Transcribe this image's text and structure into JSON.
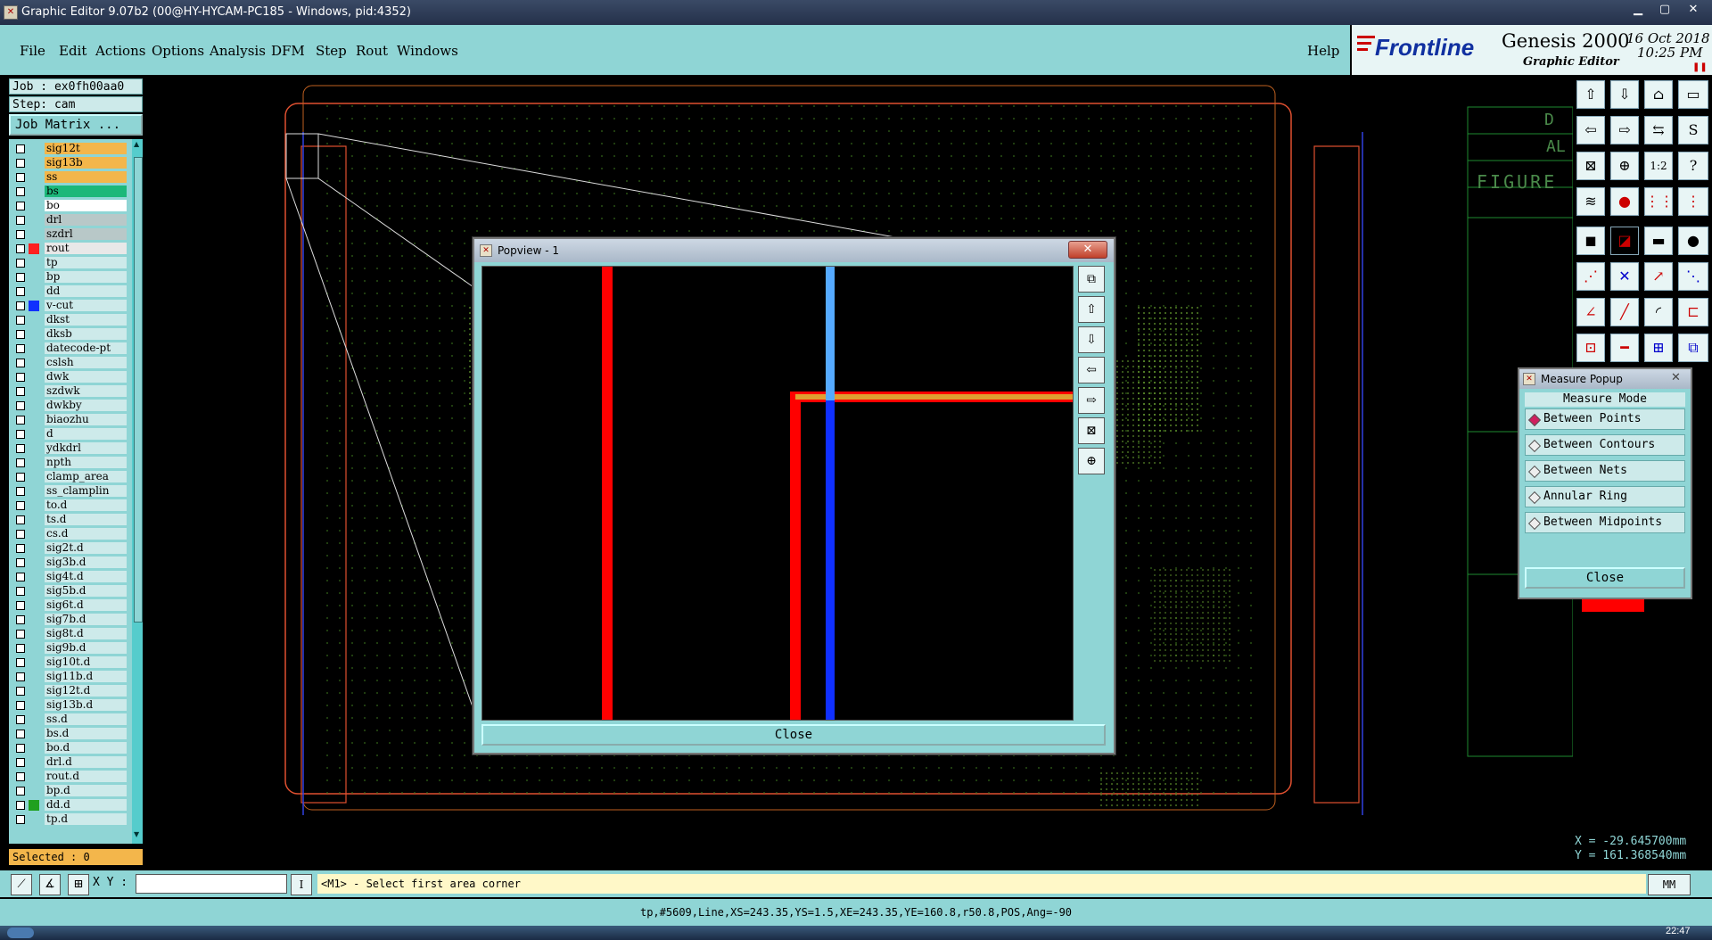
{
  "window": {
    "title": "Graphic Editor 9.07b2 (00@HY-HYCAM-PC185 - Windows, pid:4352)"
  },
  "menu": {
    "items": [
      "File",
      "Edit",
      "Actions",
      "Options",
      "Analysis",
      "DFM",
      "Step",
      "Rout",
      "Windows"
    ],
    "help": "Help"
  },
  "brand": {
    "logo": "Frontline",
    "product": "Genesis 2000",
    "subtitle": "Graphic Editor",
    "date": "16 Oct 2018",
    "time": "10:25 PM"
  },
  "job": {
    "job_label": "Job : ex0fh00aa0",
    "step_label": "Step: cam",
    "matrix_button": "Job Matrix ..."
  },
  "layers": [
    {
      "name": "sig12t",
      "color": "#f3b64b",
      "swatch": ""
    },
    {
      "name": "sig13b",
      "color": "#f3b64b",
      "swatch": ""
    },
    {
      "name": "ss",
      "color": "#f3b64b",
      "swatch": ""
    },
    {
      "name": "bs",
      "color": "#1cb87a",
      "swatch": ""
    },
    {
      "name": "bo",
      "color": "#ffffff",
      "swatch": ""
    },
    {
      "name": "drl",
      "color": "#b8c8c8",
      "swatch": ""
    },
    {
      "name": "szdrl",
      "color": "#b8c8c8",
      "swatch": ""
    },
    {
      "name": "rout",
      "color": "#e8e8e8",
      "swatch": "#ff2020"
    },
    {
      "name": "tp",
      "color": "#cdeaea",
      "swatch": ""
    },
    {
      "name": "bp",
      "color": "#cdeaea",
      "swatch": ""
    },
    {
      "name": "dd",
      "color": "#cdeaea",
      "swatch": ""
    },
    {
      "name": "v-cut",
      "color": "#cdeaea",
      "swatch": "#1030ff"
    },
    {
      "name": "dkst",
      "color": "#cdeaea",
      "swatch": ""
    },
    {
      "name": "dksb",
      "color": "#cdeaea",
      "swatch": ""
    },
    {
      "name": "datecode-pt",
      "color": "#cdeaea",
      "swatch": ""
    },
    {
      "name": "cslsh",
      "color": "#cdeaea",
      "swatch": ""
    },
    {
      "name": "dwk",
      "color": "#cdeaea",
      "swatch": ""
    },
    {
      "name": "szdwk",
      "color": "#cdeaea",
      "swatch": ""
    },
    {
      "name": "dwkby",
      "color": "#cdeaea",
      "swatch": ""
    },
    {
      "name": "biaozhu",
      "color": "#cdeaea",
      "swatch": ""
    },
    {
      "name": "d",
      "color": "#cdeaea",
      "swatch": ""
    },
    {
      "name": "ydkdrl",
      "color": "#cdeaea",
      "swatch": ""
    },
    {
      "name": "npth",
      "color": "#cdeaea",
      "swatch": ""
    },
    {
      "name": "clamp_area",
      "color": "#cdeaea",
      "swatch": ""
    },
    {
      "name": "ss_clamplin",
      "color": "#cdeaea",
      "swatch": ""
    },
    {
      "name": "to.d",
      "color": "#cdeaea",
      "swatch": ""
    },
    {
      "name": "ts.d",
      "color": "#cdeaea",
      "swatch": ""
    },
    {
      "name": "cs.d",
      "color": "#cdeaea",
      "swatch": ""
    },
    {
      "name": "sig2t.d",
      "color": "#cdeaea",
      "swatch": ""
    },
    {
      "name": "sig3b.d",
      "color": "#cdeaea",
      "swatch": ""
    },
    {
      "name": "sig4t.d",
      "color": "#cdeaea",
      "swatch": ""
    },
    {
      "name": "sig5b.d",
      "color": "#cdeaea",
      "swatch": ""
    },
    {
      "name": "sig6t.d",
      "color": "#cdeaea",
      "swatch": ""
    },
    {
      "name": "sig7b.d",
      "color": "#cdeaea",
      "swatch": ""
    },
    {
      "name": "sig8t.d",
      "color": "#cdeaea",
      "swatch": ""
    },
    {
      "name": "sig9b.d",
      "color": "#cdeaea",
      "swatch": ""
    },
    {
      "name": "sig10t.d",
      "color": "#cdeaea",
      "swatch": ""
    },
    {
      "name": "sig11b.d",
      "color": "#cdeaea",
      "swatch": ""
    },
    {
      "name": "sig12t.d",
      "color": "#cdeaea",
      "swatch": ""
    },
    {
      "name": "sig13b.d",
      "color": "#cdeaea",
      "swatch": ""
    },
    {
      "name": "ss.d",
      "color": "#cdeaea",
      "swatch": ""
    },
    {
      "name": "bs.d",
      "color": "#cdeaea",
      "swatch": ""
    },
    {
      "name": "bo.d",
      "color": "#cdeaea",
      "swatch": ""
    },
    {
      "name": "drl.d",
      "color": "#cdeaea",
      "swatch": ""
    },
    {
      "name": "rout.d",
      "color": "#cdeaea",
      "swatch": ""
    },
    {
      "name": "bp.d",
      "color": "#cdeaea",
      "swatch": ""
    },
    {
      "name": "dd.d",
      "color": "#cdeaea",
      "swatch": "#20a020"
    },
    {
      "name": "tp.d",
      "color": "#cdeaea",
      "swatch": ""
    }
  ],
  "selected": "Selected : 0",
  "canvas_text": {
    "frame_text_1": "D",
    "frame_text_2": "AL",
    "frame_text_3": "FIGURE"
  },
  "popview": {
    "title": "Popview - 1",
    "close": "Close",
    "close_x": "✕"
  },
  "measure": {
    "title": "Measure Popup",
    "mode_header": "Measure Mode",
    "options": [
      {
        "label": "Between Points",
        "selected": true
      },
      {
        "label": "Between Contours",
        "selected": false
      },
      {
        "label": "Between Nets",
        "selected": false
      },
      {
        "label": "Annular Ring",
        "selected": false
      },
      {
        "label": "Between Midpoints",
        "selected": false
      }
    ],
    "close": "Close",
    "close_x": "✕"
  },
  "coords": {
    "x": "X = -29.645700mm",
    "y": "Y = 161.368540mm"
  },
  "cmd": {
    "xy_label": "X Y :",
    "prompt": "<M1> - Select first area corner",
    "units": "MM"
  },
  "status": "tp,#5609,Line,XS=243.35,YS=1.5,XE=243.35,YE=160.8,r50.8,POS,Ang=-90",
  "taskbar": {
    "clock": "22:47"
  }
}
